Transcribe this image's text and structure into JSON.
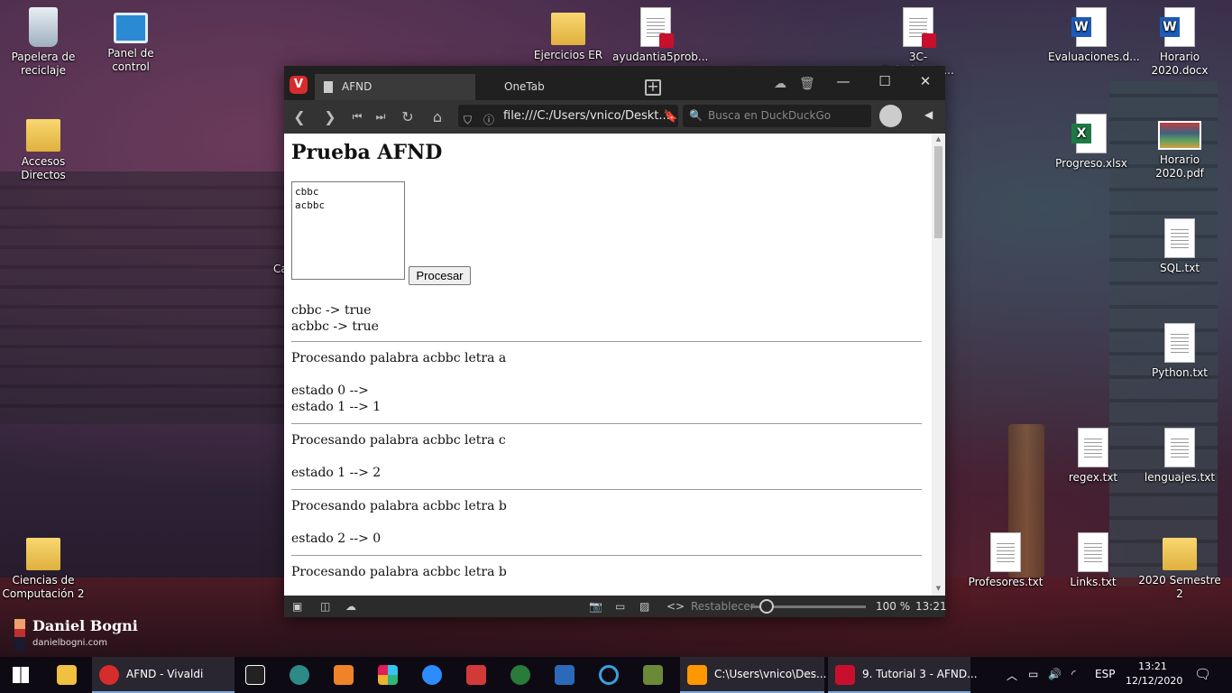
{
  "desktop": {
    "icons": [
      {
        "label": "Papelera de reciclaje"
      },
      {
        "label": "Panel de control"
      },
      {
        "label": "Ejercicios ER"
      },
      {
        "label": "ayudantia5prob..."
      },
      {
        "label": "3C-Relaciones...."
      },
      {
        "label": "Evaluaciones.d..."
      },
      {
        "label": "Horario 2020.docx"
      },
      {
        "label": "Accesos Directos"
      },
      {
        "label": "Progreso.xlsx"
      },
      {
        "label": "Horario 2020.pdf"
      },
      {
        "label": "SQL.txt"
      },
      {
        "label": "Python.txt"
      },
      {
        "label": "regex.txt"
      },
      {
        "label": "lenguajes.txt"
      },
      {
        "label": "Ciencias de Computación 2"
      },
      {
        "label": "Profesores.txt"
      },
      {
        "label": "Links.txt"
      },
      {
        "label": "2020 Semestre 2"
      }
    ],
    "partial_label": "Ca",
    "brand": {
      "name": "Daniel Bogni",
      "url": "danielbogni.com"
    }
  },
  "browser": {
    "tabs": [
      {
        "label": "AFND"
      },
      {
        "label": "OneTab"
      }
    ],
    "url": "file:///C:/Users/vnico/Deskt...",
    "search_placeholder": "Busca en DuckDuckGo",
    "status": {
      "reset_label": "Restablecer",
      "zoom": "100 %",
      "time": "13:21",
      "zoom_level": 0.14
    }
  },
  "page": {
    "title": "Prueba AFND",
    "textarea_value": "cbbc\nacbbc",
    "process_label": "Procesar",
    "results": [
      "cbbc -> true",
      "acbbc -> true"
    ],
    "steps": [
      {
        "head": "Procesando palabra acbbc letra a",
        "lines": [
          "estado 0 -->",
          "estado 1 --> 1"
        ]
      },
      {
        "head": "Procesando palabra acbbc letra c",
        "lines": [
          "estado 1 --> 2"
        ]
      },
      {
        "head": "Procesando palabra acbbc letra b",
        "lines": [
          "estado 2 --> 0"
        ]
      },
      {
        "head": "Procesando palabra acbbc letra b",
        "lines": []
      }
    ]
  },
  "taskbar": {
    "vivaldi_label": "AFND - Vivaldi",
    "explorer_label": "C:\\Users\\vnico\\Des...",
    "pdf_label": "9. Tutorial 3 - AFND...",
    "language": "ESP",
    "time": "13:21",
    "date": "12/12/2020"
  },
  "colors": {
    "vivaldi_red": "#d62c2c",
    "taskbar_bg": "#0e0a14",
    "accent_blue": "#7aa6da"
  }
}
